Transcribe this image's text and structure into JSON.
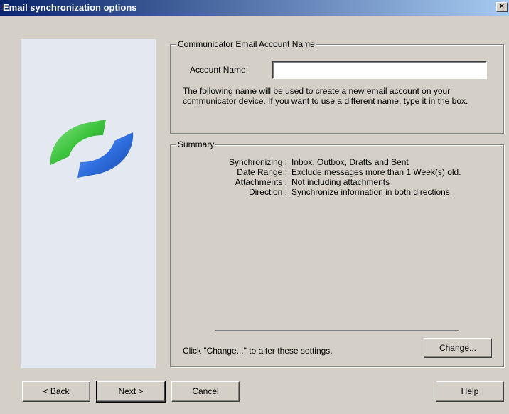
{
  "window": {
    "title": "Email synchronization options",
    "close_glyph": "×"
  },
  "account_group": {
    "legend": "Communicator Email Account Name",
    "account_label": "Account Name:",
    "account_value": "",
    "description": "The following name will be used to create a new email account on your communicator device. If you want to use a different name, type it in the box."
  },
  "summary_group": {
    "legend": "Summary",
    "rows": [
      {
        "key": "Synchronizing :",
        "value": "Inbox, Outbox, Drafts and Sent"
      },
      {
        "key": "Date Range :",
        "value": "Exclude messages more than 1 Week(s) old."
      },
      {
        "key": "Attachments :",
        "value": "Not including attachments"
      },
      {
        "key": "Direction :",
        "value": "Synchronize information in both directions."
      }
    ],
    "hint": "Click \"Change...\" to alter these settings.",
    "change_label": "Change..."
  },
  "footer": {
    "back_label": "< Back",
    "next_label": "Next >",
    "cancel_label": "Cancel",
    "help_label": "Help"
  },
  "colors": {
    "titlebar_start": "#0a246a",
    "titlebar_end": "#a6caf0",
    "logo_green": "#3cc33c",
    "logo_blue": "#2f6fe0",
    "art_panel": "#e4e9f1"
  },
  "icons": {
    "logo": "sync-arrows-icon",
    "close": "close-icon"
  }
}
